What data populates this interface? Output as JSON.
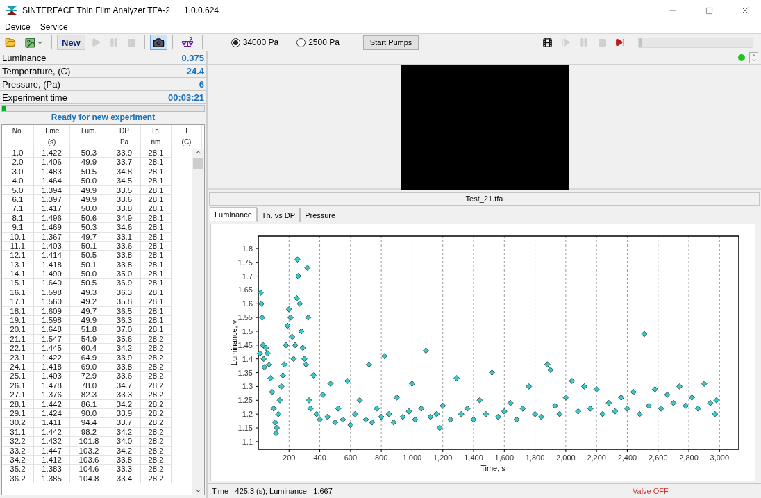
{
  "window": {
    "title": "SINTERFACE Thin Film Analyzer TFA-2",
    "version": "1.0.0.624"
  },
  "menu": [
    "Device",
    "Service"
  ],
  "toolbar": {
    "left": [
      {
        "kind": "open",
        "disabled": false,
        "selected": false
      },
      {
        "kind": "image",
        "disabled": false,
        "selected": false
      },
      {
        "kind": "new",
        "label": "New",
        "disabled": false,
        "selected": false
      },
      {
        "kind": "play",
        "disabled": true,
        "selected": false
      },
      {
        "kind": "pause",
        "disabled": true,
        "selected": false
      },
      {
        "kind": "stop",
        "disabled": true,
        "selected": false
      },
      {
        "kind": "camera",
        "disabled": false,
        "selected": true
      },
      {
        "kind": "scale",
        "disabled": false,
        "selected": false
      }
    ],
    "pressures": [
      {
        "label": "34000 Pa",
        "selected": true
      },
      {
        "label": "2500 Pa",
        "selected": false
      }
    ],
    "pump_button": "Start Pumps",
    "right": [
      {
        "kind": "film",
        "disabled": false
      },
      {
        "kind": "step",
        "disabled": true
      },
      {
        "kind": "pause",
        "disabled": true
      },
      {
        "kind": "stop",
        "disabled": true
      },
      {
        "kind": "end",
        "disabled": false
      }
    ],
    "playback": {
      "level": 0.03
    }
  },
  "readouts": [
    {
      "label": "Luminance",
      "value": "0.375"
    },
    {
      "label": "Temperature, (C)",
      "value": "24.4"
    },
    {
      "label": "Pressure, (Pa)",
      "value": "6"
    },
    {
      "label": "Experiment time",
      "value": "00:03:21"
    }
  ],
  "progress": {
    "level": 0.02
  },
  "status": "Ready for new experiment",
  "table": {
    "columns": [
      {
        "title": "No."
      },
      {
        "title": "Time",
        "unit": "(s)"
      },
      {
        "title": "Lum."
      },
      {
        "title": "DP",
        "unit": "Pa"
      },
      {
        "title": "Th.",
        "unit": "nm"
      },
      {
        "title": "T",
        "unit": "(C)"
      }
    ],
    "rows": [
      [
        "1.0",
        "1.422",
        "50.3",
        "33.9",
        "28.1"
      ],
      [
        "2.0",
        "1.406",
        "49.9",
        "33.7",
        "28.1"
      ],
      [
        "3.0",
        "1.483",
        "50.5",
        "34.8",
        "28.1"
      ],
      [
        "4.0",
        "1.464",
        "50.0",
        "34.5",
        "28.1"
      ],
      [
        "5.0",
        "1.394",
        "49.9",
        "33.5",
        "28.1"
      ],
      [
        "6.1",
        "1.397",
        "49.9",
        "33.6",
        "28.1"
      ],
      [
        "7.1",
        "1.417",
        "50.0",
        "33.8",
        "28.1"
      ],
      [
        "8.1",
        "1.496",
        "50.6",
        "34.9",
        "28.1"
      ],
      [
        "9.1",
        "1.469",
        "50.3",
        "34.6",
        "28.1"
      ],
      [
        "10.1",
        "1.367",
        "49.7",
        "33.1",
        "28.1"
      ],
      [
        "11.1",
        "1.403",
        "50.1",
        "33.6",
        "28.1"
      ],
      [
        "12.1",
        "1.414",
        "50.5",
        "33.8",
        "28.1"
      ],
      [
        "13.1",
        "1.418",
        "50.1",
        "33.8",
        "28.1"
      ],
      [
        "14.1",
        "1.499",
        "50.0",
        "35.0",
        "28.1"
      ],
      [
        "15.1",
        "1.640",
        "50.5",
        "36.9",
        "28.1"
      ],
      [
        "16.1",
        "1.598",
        "49.3",
        "36.3",
        "28.1"
      ],
      [
        "17.1",
        "1.560",
        "49.2",
        "35.8",
        "28.1"
      ],
      [
        "18.1",
        "1.609",
        "49.7",
        "36.5",
        "28.1"
      ],
      [
        "19.1",
        "1.598",
        "49.9",
        "36.3",
        "28.1"
      ],
      [
        "20.1",
        "1.648",
        "51.8",
        "37.0",
        "28.1"
      ],
      [
        "21.1",
        "1.547",
        "54.9",
        "35.6",
        "28.2"
      ],
      [
        "22.1",
        "1.445",
        "60.4",
        "34.2",
        "28.2"
      ],
      [
        "23.1",
        "1.422",
        "64.9",
        "33.9",
        "28.2"
      ],
      [
        "24.1",
        "1.418",
        "69.0",
        "33.8",
        "28.2"
      ],
      [
        "25.1",
        "1.403",
        "72.9",
        "33.6",
        "28.2"
      ],
      [
        "26.1",
        "1.478",
        "78.0",
        "34.7",
        "28.2"
      ],
      [
        "27.1",
        "1.376",
        "82.3",
        "33.3",
        "28.2"
      ],
      [
        "28.1",
        "1.442",
        "86.1",
        "34.2",
        "28.2"
      ],
      [
        "29.1",
        "1.424",
        "90.0",
        "33.9",
        "28.2"
      ],
      [
        "30.2",
        "1.411",
        "94.4",
        "33.7",
        "28.2"
      ],
      [
        "31.1",
        "1.442",
        "98.2",
        "34.2",
        "28.2"
      ],
      [
        "32.2",
        "1.432",
        "101.8",
        "34.0",
        "28.2"
      ],
      [
        "33.2",
        "1.447",
        "103.2",
        "34.2",
        "28.2"
      ],
      [
        "34.2",
        "1.412",
        "103.6",
        "33.8",
        "28.2"
      ],
      [
        "35.2",
        "1.383",
        "104.6",
        "33.3",
        "28.2"
      ],
      [
        "36.2",
        "1.385",
        "104.8",
        "33.4",
        "28.2"
      ]
    ]
  },
  "indicator": {
    "on": true
  },
  "file": "Test_21.tfa",
  "tabs": [
    {
      "label": "Luminance",
      "selected": true
    },
    {
      "label": "Th. vs DP",
      "selected": false
    },
    {
      "label": "Pressure",
      "selected": false
    }
  ],
  "chart_data": {
    "type": "scatter",
    "grid": true,
    "xlabel": "Time, s",
    "ylabel": "Luminance, v",
    "xlim": [
      0,
      3125
    ],
    "ylim": [
      1.072,
      1.845
    ],
    "xticks": [
      200,
      400,
      600,
      800,
      {
        "value": 1000,
        "label": "1,000"
      },
      {
        "value": 1200,
        "label": "1,200"
      },
      {
        "value": 1400,
        "label": "1,400"
      },
      {
        "value": 1600,
        "label": "1,600"
      },
      {
        "value": 1800,
        "label": "1,800"
      },
      {
        "value": 2000,
        "label": "2,000"
      },
      {
        "value": 2200,
        "label": "2,200"
      },
      {
        "value": 2400,
        "label": "2,400"
      },
      {
        "value": 2600,
        "label": "2,600"
      },
      {
        "value": 2800,
        "label": "2,800"
      },
      {
        "value": 3000,
        "label": "3,000"
      }
    ],
    "yticks": [
      1.1,
      1.15,
      1.2,
      1.25,
      1.3,
      1.35,
      1.4,
      1.45,
      1.5,
      1.55,
      1.6,
      1.65,
      1.7,
      1.75,
      1.8
    ],
    "x": [
      10,
      15,
      20,
      25,
      30,
      35,
      40,
      50,
      60,
      70,
      80,
      90,
      100,
      110,
      115,
      120,
      130,
      140,
      150,
      160,
      170,
      180,
      190,
      200,
      210,
      220,
      230,
      240,
      250,
      255,
      260,
      270,
      280,
      290,
      300,
      310,
      320,
      325,
      330,
      340,
      360,
      380,
      400,
      420,
      450,
      470,
      500,
      520,
      550,
      580,
      600,
      630,
      660,
      700,
      720,
      740,
      770,
      800,
      820,
      850,
      880,
      900,
      940,
      980,
      1000,
      1020,
      1060,
      1090,
      1120,
      1160,
      1180,
      1200,
      1250,
      1290,
      1320,
      1360,
      1400,
      1440,
      1480,
      1520,
      1560,
      1600,
      1640,
      1680,
      1720,
      1760,
      1800,
      1840,
      1880,
      1900,
      1930,
      1960,
      2000,
      2040,
      2080,
      2120,
      2160,
      2200,
      2240,
      2280,
      2320,
      2360,
      2400,
      2440,
      2480,
      2510,
      2540,
      2580,
      2620,
      2660,
      2700,
      2740,
      2780,
      2820,
      2860,
      2900,
      2940,
      2970,
      2980
    ],
    "series": [
      {
        "color": "#3cc8c8",
        "values": [
          1.42,
          1.64,
          1.6,
          1.55,
          1.45,
          1.4,
          1.37,
          1.44,
          1.42,
          1.38,
          1.33,
          1.28,
          1.22,
          1.17,
          1.13,
          1.15,
          1.2,
          1.25,
          1.3,
          1.34,
          1.38,
          1.45,
          1.52,
          1.58,
          1.55,
          1.48,
          1.4,
          1.45,
          1.62,
          1.76,
          1.7,
          1.6,
          1.5,
          1.44,
          1.4,
          1.38,
          1.73,
          1.55,
          1.25,
          1.22,
          1.34,
          1.2,
          1.18,
          1.27,
          1.19,
          1.31,
          1.17,
          1.22,
          1.18,
          1.32,
          1.16,
          1.2,
          1.25,
          1.18,
          1.38,
          1.17,
          1.22,
          1.19,
          1.41,
          1.2,
          1.17,
          1.26,
          1.19,
          1.21,
          1.31,
          1.18,
          1.22,
          1.43,
          1.19,
          1.2,
          1.15,
          1.23,
          1.18,
          1.33,
          1.2,
          1.22,
          1.18,
          1.25,
          1.2,
          1.35,
          1.19,
          1.21,
          1.24,
          1.18,
          1.22,
          1.3,
          1.2,
          1.19,
          1.38,
          1.36,
          1.23,
          1.2,
          1.26,
          1.32,
          1.21,
          1.3,
          1.22,
          1.29,
          1.2,
          1.24,
          1.21,
          1.26,
          1.22,
          1.28,
          1.2,
          1.49,
          1.23,
          1.29,
          1.22,
          1.27,
          1.24,
          1.3,
          1.23,
          1.26,
          1.22,
          1.31,
          1.24,
          1.2,
          1.25
        ]
      }
    ]
  },
  "status_bar": {
    "reading": "Time= 425.3 (s); Luminance= 1.667",
    "valve": "Valve OFF"
  }
}
